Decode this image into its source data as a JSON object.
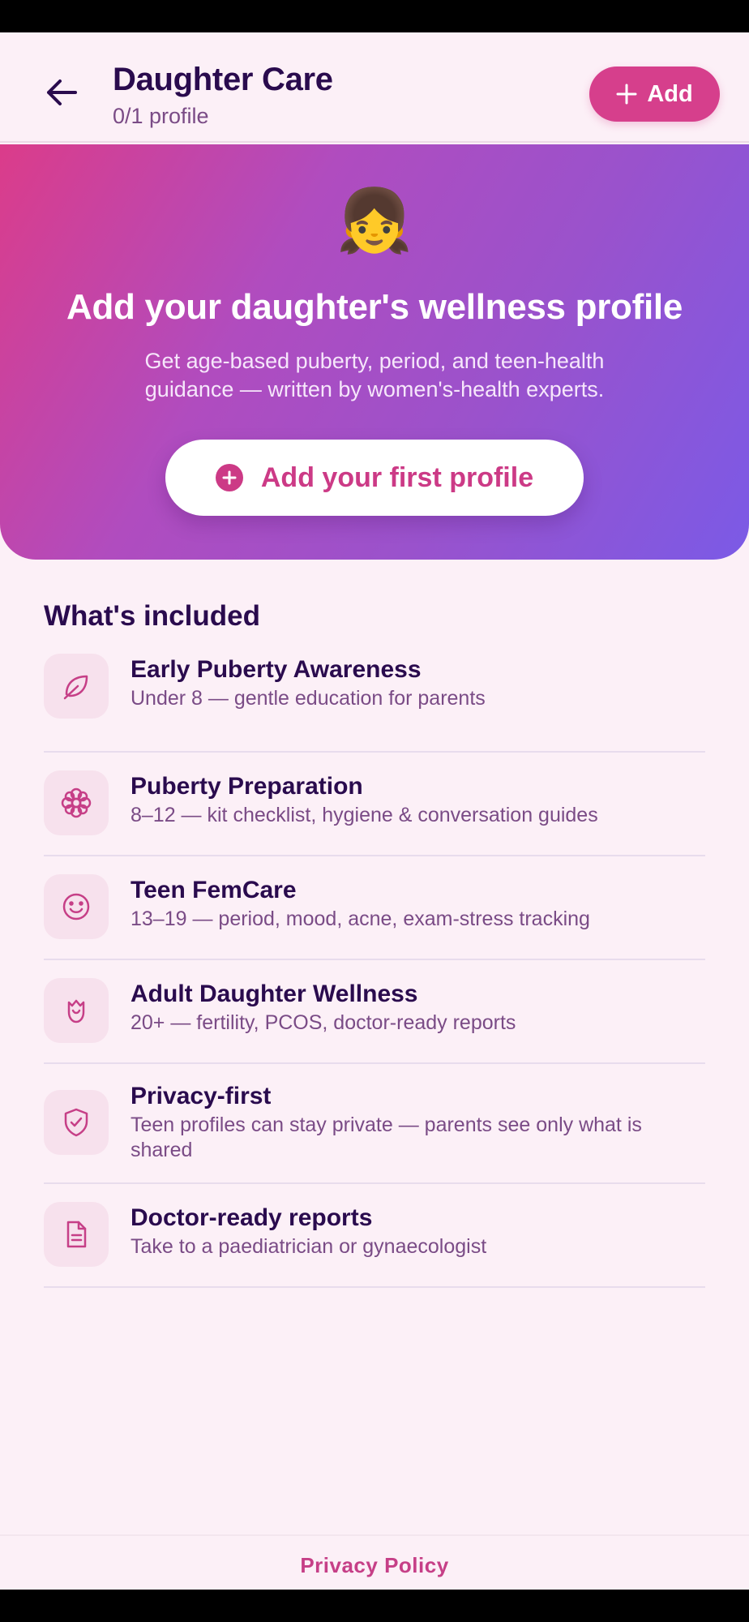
{
  "header": {
    "title": "Daughter Care",
    "subtitle": "0/1 profile",
    "add_label": "Add"
  },
  "hero": {
    "emoji": "👧",
    "title": "Add your daughter's wellness profile",
    "description": "Get age-based puberty, period, and teen-health guidance — written by women's-health experts.",
    "cta_label": "Add your first profile"
  },
  "included": {
    "title": "What's included",
    "items": [
      {
        "icon": "leaf-icon",
        "title": "Early Puberty Awareness",
        "desc": "Under 8 — gentle education for parents"
      },
      {
        "icon": "flower-icon",
        "title": "Puberty Preparation",
        "desc": "8–12 — kit checklist, hygiene & conversation guides"
      },
      {
        "icon": "smile-icon",
        "title": "Teen FemCare",
        "desc": "13–19 — period, mood, acne, exam-stress tracking"
      },
      {
        "icon": "rose-icon",
        "title": "Adult Daughter Wellness",
        "desc": "20+ — fertility, PCOS, doctor-ready reports"
      },
      {
        "icon": "shield-check-icon",
        "title": "Privacy-first",
        "desc": "Teen profiles can stay private — parents see only what is shared"
      },
      {
        "icon": "document-icon",
        "title": "Doctor-ready reports",
        "desc": "Take to a paediatrician or gynaecologist"
      }
    ]
  },
  "footer": {
    "privacy_label": "Privacy Policy"
  },
  "colors": {
    "accent": "#d63f8c",
    "heading": "#2a0b4e",
    "muted": "#7a4b86",
    "background": "#fcf0f7"
  }
}
